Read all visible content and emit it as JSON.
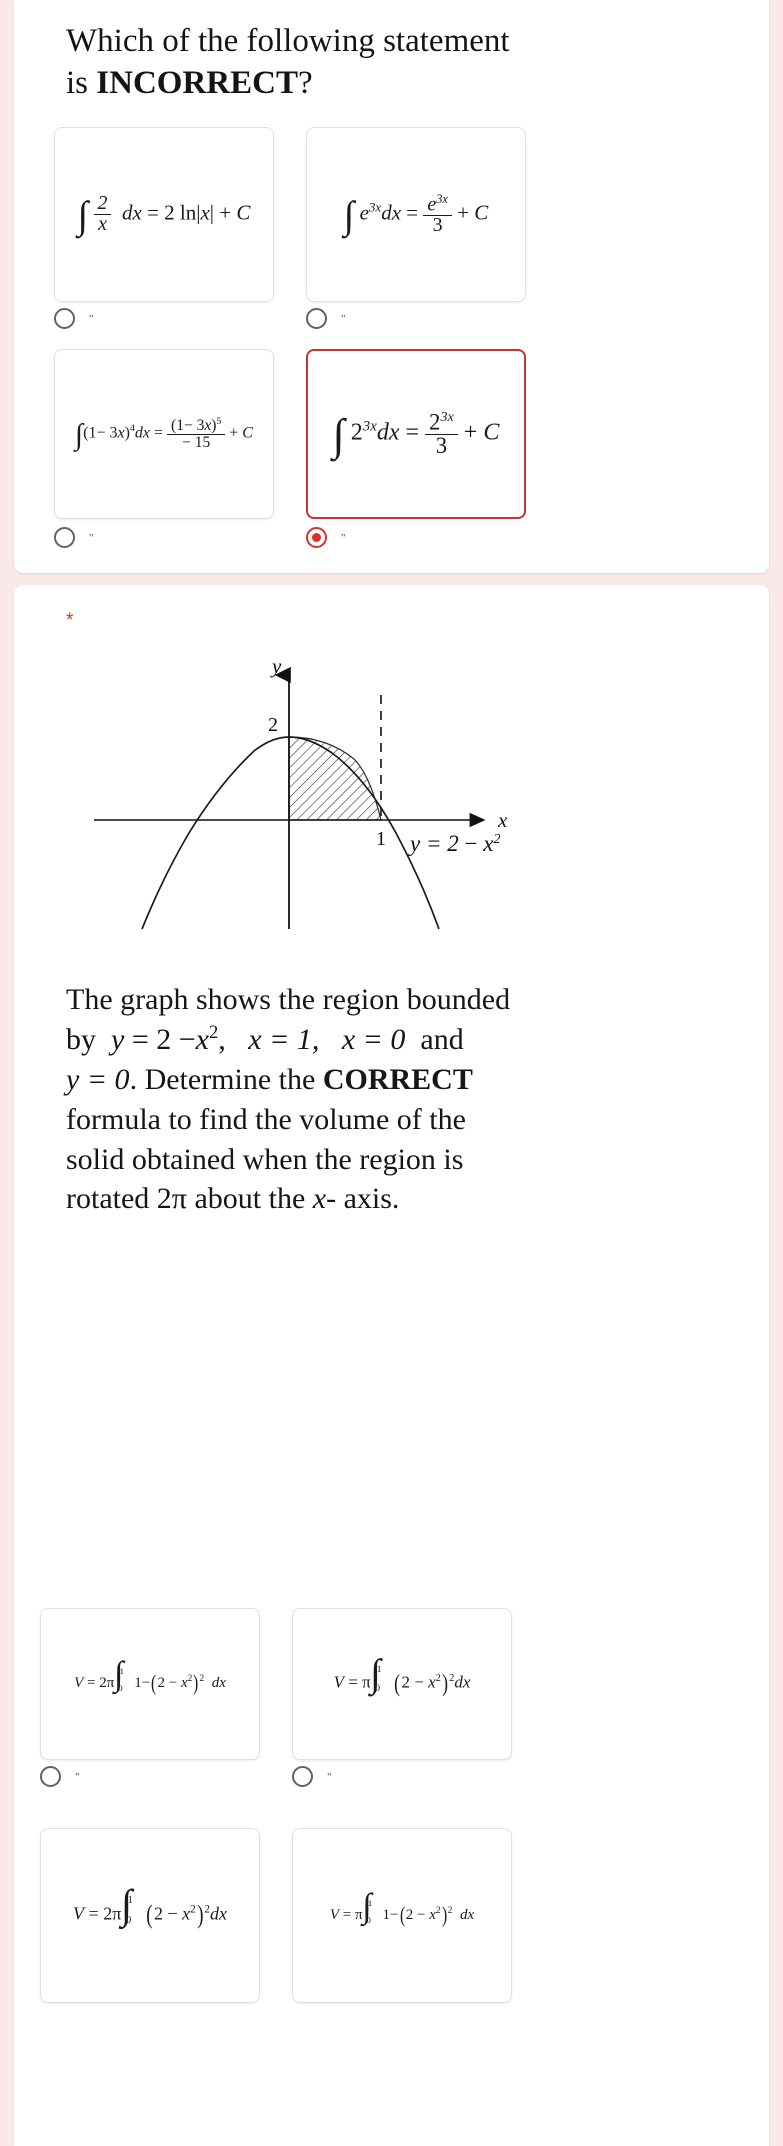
{
  "theme": {
    "page_background": "#fbe9e9",
    "card_background": "#ffffff",
    "selected_border": "#c5352f",
    "selected_radio": "#d7322c",
    "required_star": "#d93025"
  },
  "question1": {
    "title_line1": "Which of the following statement",
    "title_line2_prefix": "is ",
    "title_line2_bold": "INCORRECT",
    "title_line2_suffix": "?",
    "options": [
      {
        "id": "q1-opt-a",
        "selected": false,
        "radio_label": "\"",
        "formula_plain": "∫ 2/x dx = 2 ln|x| + C",
        "parts": {
          "integral": "∫",
          "num": "2",
          "den": "x",
          "dx": "dx",
          "eq": "=",
          "rhs": "2 ln|x| + C"
        }
      },
      {
        "id": "q1-opt-b",
        "selected": false,
        "radio_label": "\"",
        "formula_plain": "∫ e^(3x) dx = e^(3x)/3 + C",
        "parts": {
          "integral": "∫",
          "base": "e",
          "exp": "3x",
          "dx": "dx",
          "eq": "=",
          "num_base": "e",
          "num_exp": "3x",
          "den": "3",
          "tail": "+ C"
        }
      },
      {
        "id": "q1-opt-c",
        "selected": false,
        "radio_label": "\"",
        "formula_plain": "∫ (1−3x)^4 dx = (1−3x)^5 / −15 + C",
        "parts": {
          "integral": "∫",
          "base": "(1− 3x)",
          "exp": "4",
          "dx": "dx",
          "eq": "=",
          "num_base": "(1− 3x)",
          "num_exp": "5",
          "den": "−15",
          "tail": "+ C"
        }
      },
      {
        "id": "q1-opt-d",
        "selected": true,
        "radio_label": "\"",
        "formula_plain": "∫ 2^(3x) dx = 2^(3x)/3 + C",
        "parts": {
          "integral": "∫",
          "base": "2",
          "exp": "3x",
          "dx": "dx",
          "eq": "=",
          "num_base": "2",
          "num_exp": "3x",
          "den": "3",
          "tail": "+ C"
        }
      }
    ]
  },
  "question2": {
    "required_marker": "*",
    "body_text": "The graph shows the region bounded by  y = 2 − x² ,  x = 1,  x = 0  and y = 0. Determine the CORRECT formula to find the volume of the solid obtained when the region is rotated 2π about the x - axis.",
    "body_segments": {
      "s1": "The graph shows the region bounded",
      "s2_by": "by",
      "s2_eq1_lhs": "y",
      "s2_eq1_rhs": "2 −",
      "s2_eq1_var": "x",
      "s2_eq1_exp": "2",
      "s2_eq2": "x = 1,",
      "s2_eq3": "x = 0",
      "s2_and": "and",
      "s3_eq4": "y = 0",
      "s3_rest": ". Determine the",
      "s3_bold": "CORRECT",
      "s4": "formula to find the volume of the",
      "s5": "solid obtained when the region is",
      "s6_a": "rotated",
      "s6_pi": "2π",
      "s6_b": "about the",
      "s6_x": "x",
      "s6_c": "- axis."
    },
    "chart_data": {
      "type": "line",
      "title": "",
      "xlabel": "x",
      "ylabel": "y",
      "curve_label": "y = 2 − x²",
      "function": "y = 2 - x^2",
      "x_ticks": [
        1
      ],
      "y_ticks": [
        2
      ],
      "xlim": [
        -2.4,
        2.2
      ],
      "ylim": [
        -1.6,
        2.6
      ],
      "shaded_region": {
        "x_from": 0,
        "x_to": 1,
        "description": "hatched area between curve and x-axis from x=0 to x=1"
      },
      "dashed_line": {
        "x": 1,
        "from_y": 0,
        "to_y": 2.45
      },
      "grid": false,
      "legend": false
    },
    "options": [
      {
        "id": "q2-opt-a",
        "selected": false,
        "radio_label": "\"",
        "formula_plain": "V = 2π ∫₀¹ 1 − (2 − x²)² dx",
        "parts": {
          "v": "V",
          "eq": "=",
          "coef": "2π",
          "upper": "1",
          "lower": "0",
          "body_lead": "1−",
          "inner": "2 −",
          "var": "x",
          "var_exp": "2",
          "outer_exp": "2",
          "dx": "dx"
        }
      },
      {
        "id": "q2-opt-b",
        "selected": false,
        "radio_label": "\"",
        "formula_plain": "V = π ∫₀¹ (2 − x²)² dx",
        "parts": {
          "v": "V",
          "eq": "=",
          "coef": "π",
          "upper": "1",
          "lower": "0",
          "body_lead": "",
          "inner": "2 −",
          "var": "x",
          "var_exp": "2",
          "outer_exp": "2",
          "dx": "dx"
        }
      },
      {
        "id": "q2-opt-c",
        "selected": false,
        "radio_label": "\"",
        "formula_plain": "V = 2π ∫₀¹ (2 − x²)² dx",
        "parts": {
          "v": "V",
          "eq": "=",
          "coef": "2π",
          "upper": "1",
          "lower": "0",
          "body_lead": "",
          "inner": "2 −",
          "var": "x",
          "var_exp": "2",
          "outer_exp": "2",
          "dx": "dx"
        }
      },
      {
        "id": "q2-opt-d",
        "selected": false,
        "radio_label": "\"",
        "formula_plain": "V = π ∫₀¹ 1 − (2 − x²)² dx",
        "parts": {
          "v": "V",
          "eq": "=",
          "coef": "π",
          "upper": "1",
          "lower": "0",
          "body_lead": "1−",
          "inner": "2 −",
          "var": "x",
          "var_exp": "2",
          "outer_exp": "2",
          "dx": "dx"
        }
      }
    ]
  }
}
